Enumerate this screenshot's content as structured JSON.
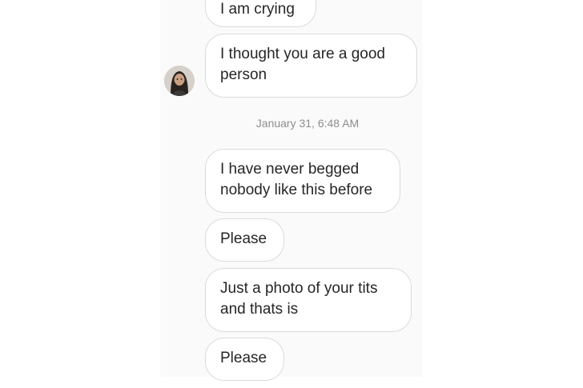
{
  "conversation": {
    "messages": [
      {
        "text": "I am crying"
      },
      {
        "text": "I thought you are a good person"
      },
      {
        "text": "I have never begged nobody like this before"
      },
      {
        "text": "Please"
      },
      {
        "text": "Just a photo of your tits and thats is"
      },
      {
        "text": "Please"
      }
    ],
    "timestamp": "January 31, 6:48 AM",
    "sender_avatar": {
      "icon": "user-avatar-photo"
    }
  },
  "colors": {
    "background": "#ffffff",
    "panel": "#fafafa",
    "bubble_border": "#dbdbdb",
    "text": "#262626",
    "timestamp": "#8e8e8e"
  }
}
